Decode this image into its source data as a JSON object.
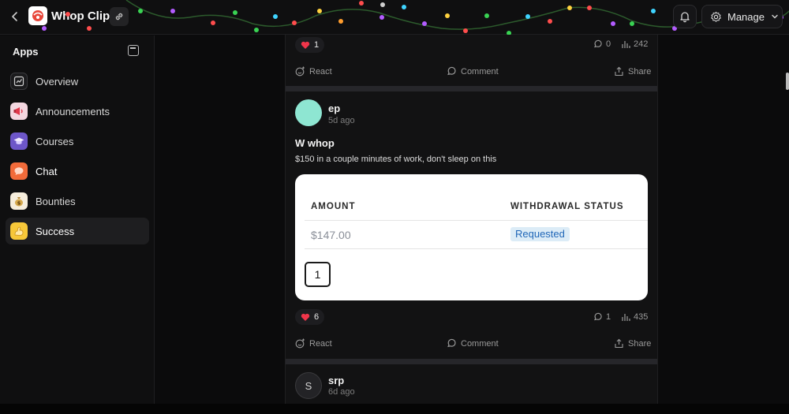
{
  "header": {
    "back_icon": "chevron-left-icon",
    "app_title": "Whop Clips",
    "link_icon": "link-icon",
    "bell_icon": "bell-icon",
    "manage_label": "Manage",
    "manage_icon": "gear-icon",
    "manage_chevron": "chevron-down-icon"
  },
  "sidebar": {
    "header": "Apps",
    "items": [
      {
        "label": "Overview",
        "icon": "overview-icon"
      },
      {
        "label": "Announcements",
        "icon": "megaphone-icon"
      },
      {
        "label": "Courses",
        "icon": "graduation-cap-icon"
      },
      {
        "label": "Chat",
        "icon": "chat-bubble-icon"
      },
      {
        "label": "Bounties",
        "icon": "money-bag-icon"
      },
      {
        "label": "Success",
        "icon": "flexed-arm-icon",
        "active": true
      }
    ]
  },
  "feed": {
    "post_top": {
      "reaction_count": "1",
      "comments": "0",
      "views": "242"
    },
    "actions": {
      "react": "React",
      "comment": "Comment",
      "share": "Share"
    },
    "post_main": {
      "author": "ep",
      "time": "5d ago",
      "title": "W whop",
      "body": "$150 in a couple minutes of work, don't sleep on this",
      "table": {
        "columns": [
          "AMOUNT",
          "WITHDRAWAL STATUS"
        ],
        "rows": [
          {
            "amount": "$147.00",
            "status": "Requested"
          }
        ],
        "page": "1"
      },
      "reaction_count": "6",
      "comments": "1",
      "views": "435"
    },
    "post_next": {
      "author": "srp",
      "time": "6d ago",
      "avatar_letter": "S"
    }
  },
  "colors": {
    "accent_avatar": "#8ee6d2",
    "status_text": "#2167b8",
    "status_bg": "#dcecf7"
  }
}
